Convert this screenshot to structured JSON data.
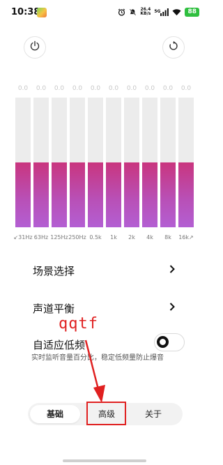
{
  "status_bar": {
    "time": "10:38",
    "net_speed_value": "26.4",
    "net_speed_unit": "KB/s",
    "network": "5G",
    "battery": "88"
  },
  "equalizer": {
    "bands": [
      {
        "label": "↙31Hz",
        "value": "0.0",
        "level": 0.5
      },
      {
        "label": "63Hz",
        "value": "0.0",
        "level": 0.5
      },
      {
        "label": "125Hz",
        "value": "0.0",
        "level": 0.5
      },
      {
        "label": "250Hz",
        "value": "0.0",
        "level": 0.5
      },
      {
        "label": "0.5k",
        "value": "0.0",
        "level": 0.5
      },
      {
        "label": "1k",
        "value": "0.0",
        "level": 0.5
      },
      {
        "label": "2k",
        "value": "0.0",
        "level": 0.5
      },
      {
        "label": "4k",
        "value": "0.0",
        "level": 0.5
      },
      {
        "label": "8k",
        "value": "0.0",
        "level": 0.5
      },
      {
        "label": "16k↗",
        "value": "0.0",
        "level": 0.5
      }
    ]
  },
  "settings": {
    "scene": {
      "label": "场景选择"
    },
    "channel_balance": {
      "label": "声道平衡"
    },
    "adaptive_bass": {
      "label": "自适应低频",
      "description": "实时监听音量百分比，稳定低频量防止爆音",
      "enabled": false
    }
  },
  "tabs": [
    {
      "label": "基础",
      "active": true
    },
    {
      "label": "高级",
      "active": false
    },
    {
      "label": "关于",
      "active": false
    }
  ],
  "annotation": {
    "text": "qqtf",
    "color": "#e02020"
  },
  "colors": {
    "eq_fill_top": "#c9357e",
    "eq_fill_bottom": "#b35fd3",
    "eq_track": "#ececec",
    "battery": "#2fbf3f"
  }
}
